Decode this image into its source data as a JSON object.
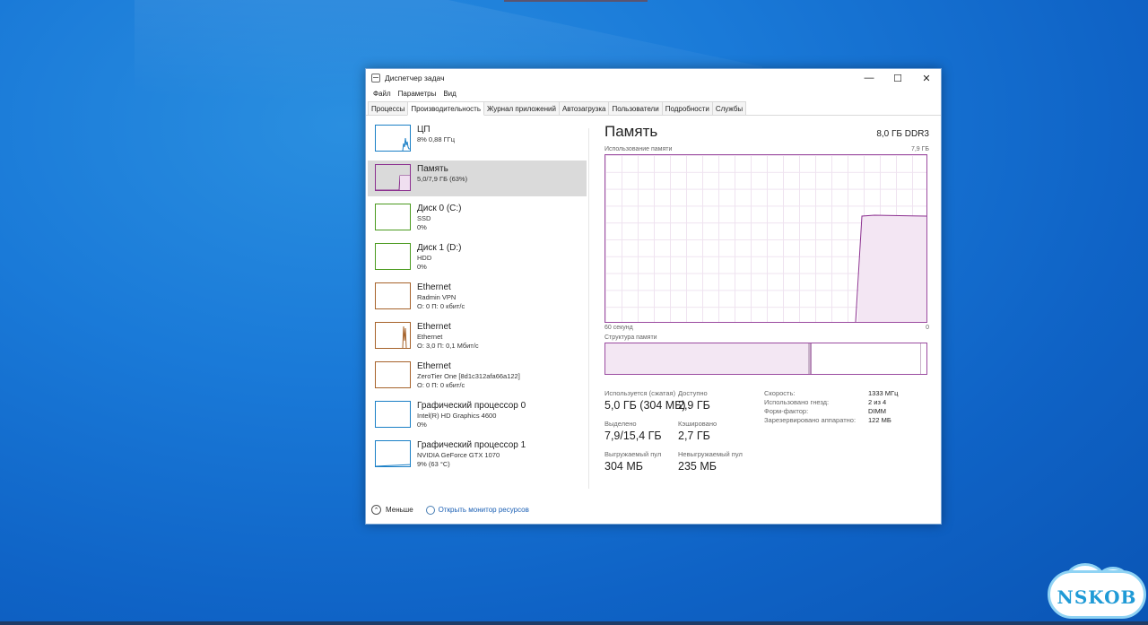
{
  "window": {
    "title": "Диспетчер задач",
    "controls": {
      "minimize": "—",
      "maximize": "☐",
      "close": "✕"
    }
  },
  "menu": [
    "Файл",
    "Параметры",
    "Вид"
  ],
  "tabs": [
    "Процессы",
    "Производительность",
    "Журнал приложений",
    "Автозагрузка",
    "Пользователи",
    "Подробности",
    "Службы"
  ],
  "active_tab": "Производительность",
  "sidebar": [
    {
      "name": "ЦП",
      "line1": "8% 0,88 ГГц",
      "line2": "",
      "color": "#1a7fc6"
    },
    {
      "name": "Память",
      "line1": "5,0/7,9 ГБ (63%)",
      "line2": "",
      "color": "#8b2f8f"
    },
    {
      "name": "Диск 0 (C:)",
      "line1": "SSD",
      "line2": "0%",
      "color": "#4a9a1e"
    },
    {
      "name": "Диск 1 (D:)",
      "line1": "HDD",
      "line2": "0%",
      "color": "#4a9a1e"
    },
    {
      "name": "Ethernet",
      "line1": "Radmin VPN",
      "line2": "О: 0 П: 0 кбит/с",
      "color": "#a6622a"
    },
    {
      "name": "Ethernet",
      "line1": "Ethernet",
      "line2": "О: 3,0 П: 0,1 Мбит/с",
      "color": "#a6622a"
    },
    {
      "name": "Ethernet",
      "line1": "ZeroTier One [8d1c312afa66a122]",
      "line2": "О: 0 П: 0 кбит/с",
      "color": "#a6622a"
    },
    {
      "name": "Графический процессор 0",
      "line1": "Intel(R) HD Graphics 4600",
      "line2": "0%",
      "color": "#1a7fc6"
    },
    {
      "name": "Графический процессор 1",
      "line1": "NVIDIA GeForce GTX 1070",
      "line2": "9% (63 °C)",
      "color": "#1a7fc6"
    }
  ],
  "memory": {
    "title": "Память",
    "spec": "8,0 ГБ DDR3",
    "usage_label": "Использование памяти",
    "usage_max": "7,9 ГБ",
    "x_left": "60 секунд",
    "x_right": "0",
    "structure_label": "Структура памяти",
    "usage_fraction": 0.63,
    "stats": {
      "in_use_label": "Используется (сжатая)",
      "in_use": "5,0 ГБ (304 МБ)",
      "available_label": "Доступно",
      "available": "2,9 ГБ",
      "committed_label": "Выделено",
      "committed": "7,9/15,4 ГБ",
      "cached_label": "Кэшировано",
      "cached": "2,7 ГБ",
      "paged_label": "Выгружаемый пул",
      "paged": "304 МБ",
      "nonpaged_label": "Невыгружаемый пул",
      "nonpaged": "235 МБ"
    },
    "props": [
      {
        "label": "Скорость:",
        "value": "1333 МГц"
      },
      {
        "label": "Использовано гнезд:",
        "value": "2 из 4"
      },
      {
        "label": "Форм-фактор:",
        "value": "DIMM"
      },
      {
        "label": "Зарезервировано аппаратно:",
        "value": "122 МБ"
      }
    ]
  },
  "footer": {
    "less": "Меньше",
    "monitor": "Открыть монитор ресурсов"
  },
  "watermark": "NSKOB"
}
